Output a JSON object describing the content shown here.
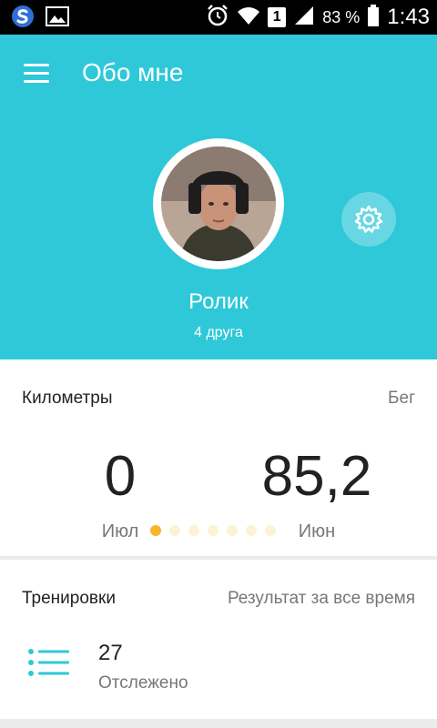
{
  "status_bar": {
    "battery": "83 %",
    "sim_slot": "1",
    "time": "1:43"
  },
  "header": {
    "title": "Обо мне",
    "user_name": "Ролик",
    "friends": "4 друга",
    "accent_color": "#2ec8d8"
  },
  "kilometers_card": {
    "title": "Километры",
    "activity": "Бег",
    "stats": [
      {
        "value": "0",
        "label": "Июл"
      },
      {
        "value": "85,2",
        "label": "Июн"
      }
    ],
    "pager": {
      "count": 7,
      "active_index": 0
    }
  },
  "training_card": {
    "title": "Тренировки",
    "filter": "Результат за все время",
    "count": "27",
    "count_label": "Отслежено"
  }
}
